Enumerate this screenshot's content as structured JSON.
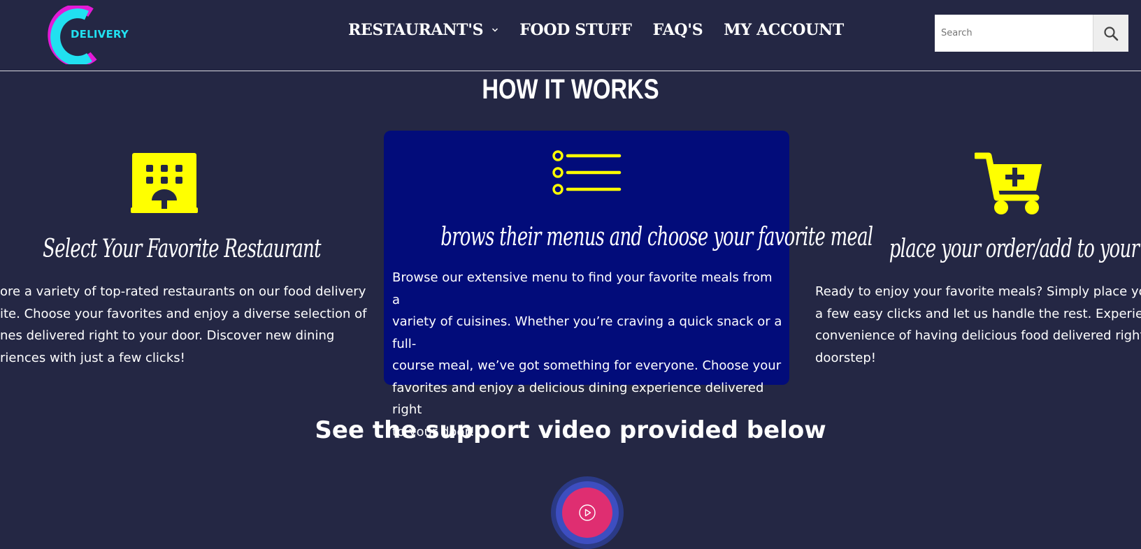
{
  "header": {
    "logo_text": "DELIVERY",
    "nav": [
      {
        "label": "RESTAURANT'S"
      },
      {
        "label": "FOOD STUFF"
      },
      {
        "label": "FAQ'S"
      },
      {
        "label": "MY ACCOUNT"
      }
    ],
    "search": {
      "placeholder": "Search",
      "value": ""
    }
  },
  "how_it_works": {
    "title": "HOW IT WORKS",
    "steps": [
      {
        "icon": "restaurant-building-icon",
        "heading": "Select Your Favorite Restaurant",
        "lines": [
          "ore a variety of top-rated restaurants on our food delivery",
          "ite. Choose your favorites and enjoy a diverse selection of",
          "nes delivered right to your door. Discover new dining",
          "riences with just a few clicks!"
        ]
      },
      {
        "icon": "menu-list-icon",
        "heading": "brows their menus and choose your favorite meal",
        "lines": [
          "Browse our extensive menu to find your favorite meals from a",
          "variety of cuisines. Whether you’re craving a quick snack or a full-",
          "course meal, we’ve got something for everyone. Choose your",
          "favorites and enjoy a delicious dining experience delivered right",
          "to your door!"
        ]
      },
      {
        "icon": "cart-plus-icon",
        "heading": "place your order/add to your cart",
        "lines": [
          "Ready to enjoy your favorite meals? Simply place your o",
          "a few easy clicks and let us handle the rest. Experience t",
          "convenience of having delicious food delivered right to",
          "doorstep!"
        ]
      }
    ]
  },
  "video": {
    "title": "See the support video provided below"
  },
  "colors": {
    "background": "#242744",
    "card_highlight": "#020c7a",
    "icon_yellow": "#ffff00",
    "logo_cyan": "#21e0f0",
    "logo_magenta": "#e31ad6",
    "play_button": "#df2e71"
  }
}
